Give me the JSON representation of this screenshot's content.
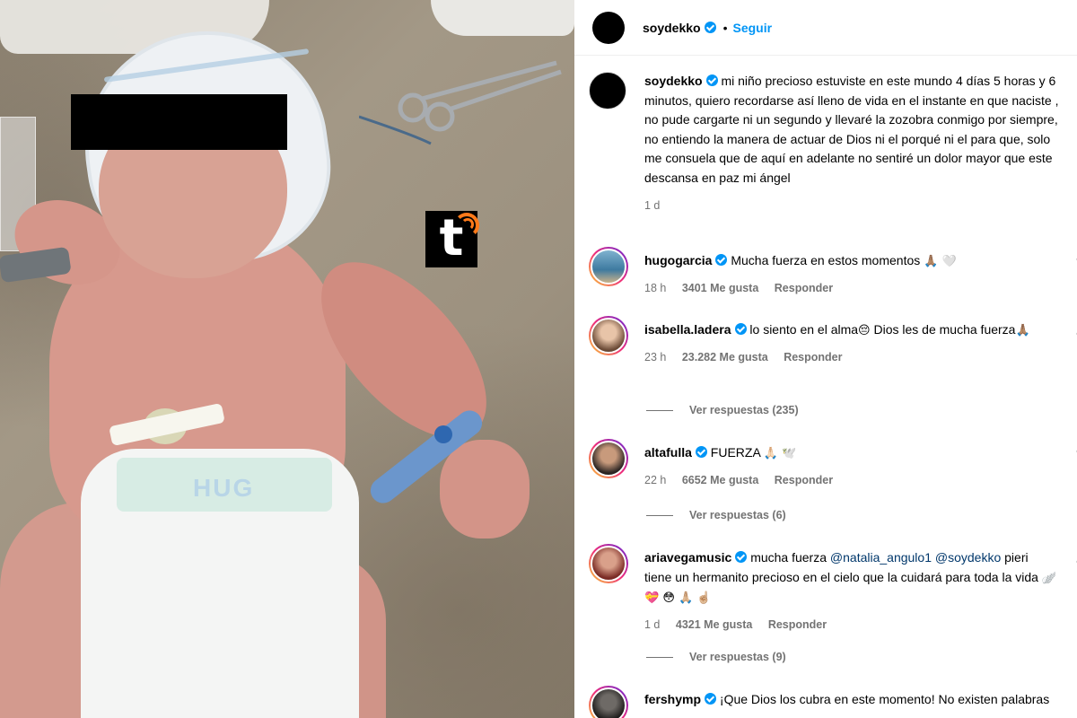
{
  "watermark": {
    "letter": "t"
  },
  "header": {
    "username": "soydekko",
    "separator": "•",
    "follow_label": "Seguir"
  },
  "caption": {
    "username": "soydekko",
    "text": "mi niño precioso estuviste en este mundo 4 días 5 horas y 6 minutos, quiero recordarse así lleno de vida en el instante en que naciste , no pude cargarte ni un segundo y llevaré la zozobra conmigo por siempre, no entiendo la manera de actuar de Dios ni el porqué ni el para que, solo me consuela que de aquí en adelante no sentiré un dolor mayor que este descansa en paz mi ángel",
    "time": "1 d"
  },
  "comments": [
    {
      "username": "hugogarcia",
      "text": "Mucha fuerza en estos momentos",
      "emojis": "🙏🏽 🤍",
      "time": "18 h",
      "likes": "3401 Me gusta",
      "reply_label": "Responder",
      "replies": ""
    },
    {
      "username": "isabella.ladera",
      "text": "lo siento en el alma",
      "text_b": "Dios les de mucha fuerza",
      "emoji_a": "😔",
      "emoji_b": "🙏🏽",
      "time": "23 h",
      "likes": "23.282 Me gusta",
      "reply_label": "Responder",
      "replies": "Ver respuestas (235)"
    },
    {
      "username": "altafulla",
      "text": "FUERZA",
      "emojis": "🙏🏻 🕊️",
      "time": "22 h",
      "likes": "6652 Me gusta",
      "reply_label": "Responder",
      "replies": "Ver respuestas (6)"
    },
    {
      "username": "ariavegamusic",
      "text": "mucha fuerza",
      "mention_1": "@natalia_angulo1",
      "mention_2": "@soydekko",
      "text_b": "pieri tiene un hermanito precioso en el cielo que la cuidará para toda la vida",
      "emojis": "🪽 💝 😳 🙏🏼 ☝🏼",
      "time": "1 d",
      "likes": "4321 Me gusta",
      "reply_label": "Responder",
      "replies": "Ver respuestas (9)"
    },
    {
      "username": "fershymp",
      "text": "¡Que Dios los cubra en este momento! No existen palabras"
    }
  ]
}
